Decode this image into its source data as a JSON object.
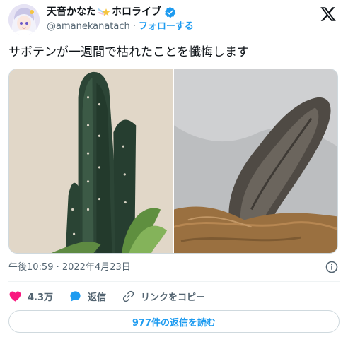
{
  "author": {
    "display_name": "天音かなた",
    "display_name_suffix": "ホロライブ",
    "handle": "@amanekanatach",
    "separator": "·",
    "follow_label": "フォローする"
  },
  "tweet": {
    "text": "サボテンが一週間で枯れたことを懺悔します"
  },
  "media": {
    "images": [
      {
        "alt": "green cactus"
      },
      {
        "alt": "withered cactus"
      }
    ]
  },
  "meta": {
    "timestamp": "午後10:59 · 2022年4月23日"
  },
  "actions": {
    "like_count": "4.3万",
    "reply_label": "返信",
    "copy_link_label": "リンクをコピー"
  },
  "replies_button": {
    "label": "977件の返信を読む"
  },
  "colors": {
    "accent": "#1d9bf0",
    "like": "#f91880",
    "muted": "#536471",
    "text": "#0f1419"
  }
}
